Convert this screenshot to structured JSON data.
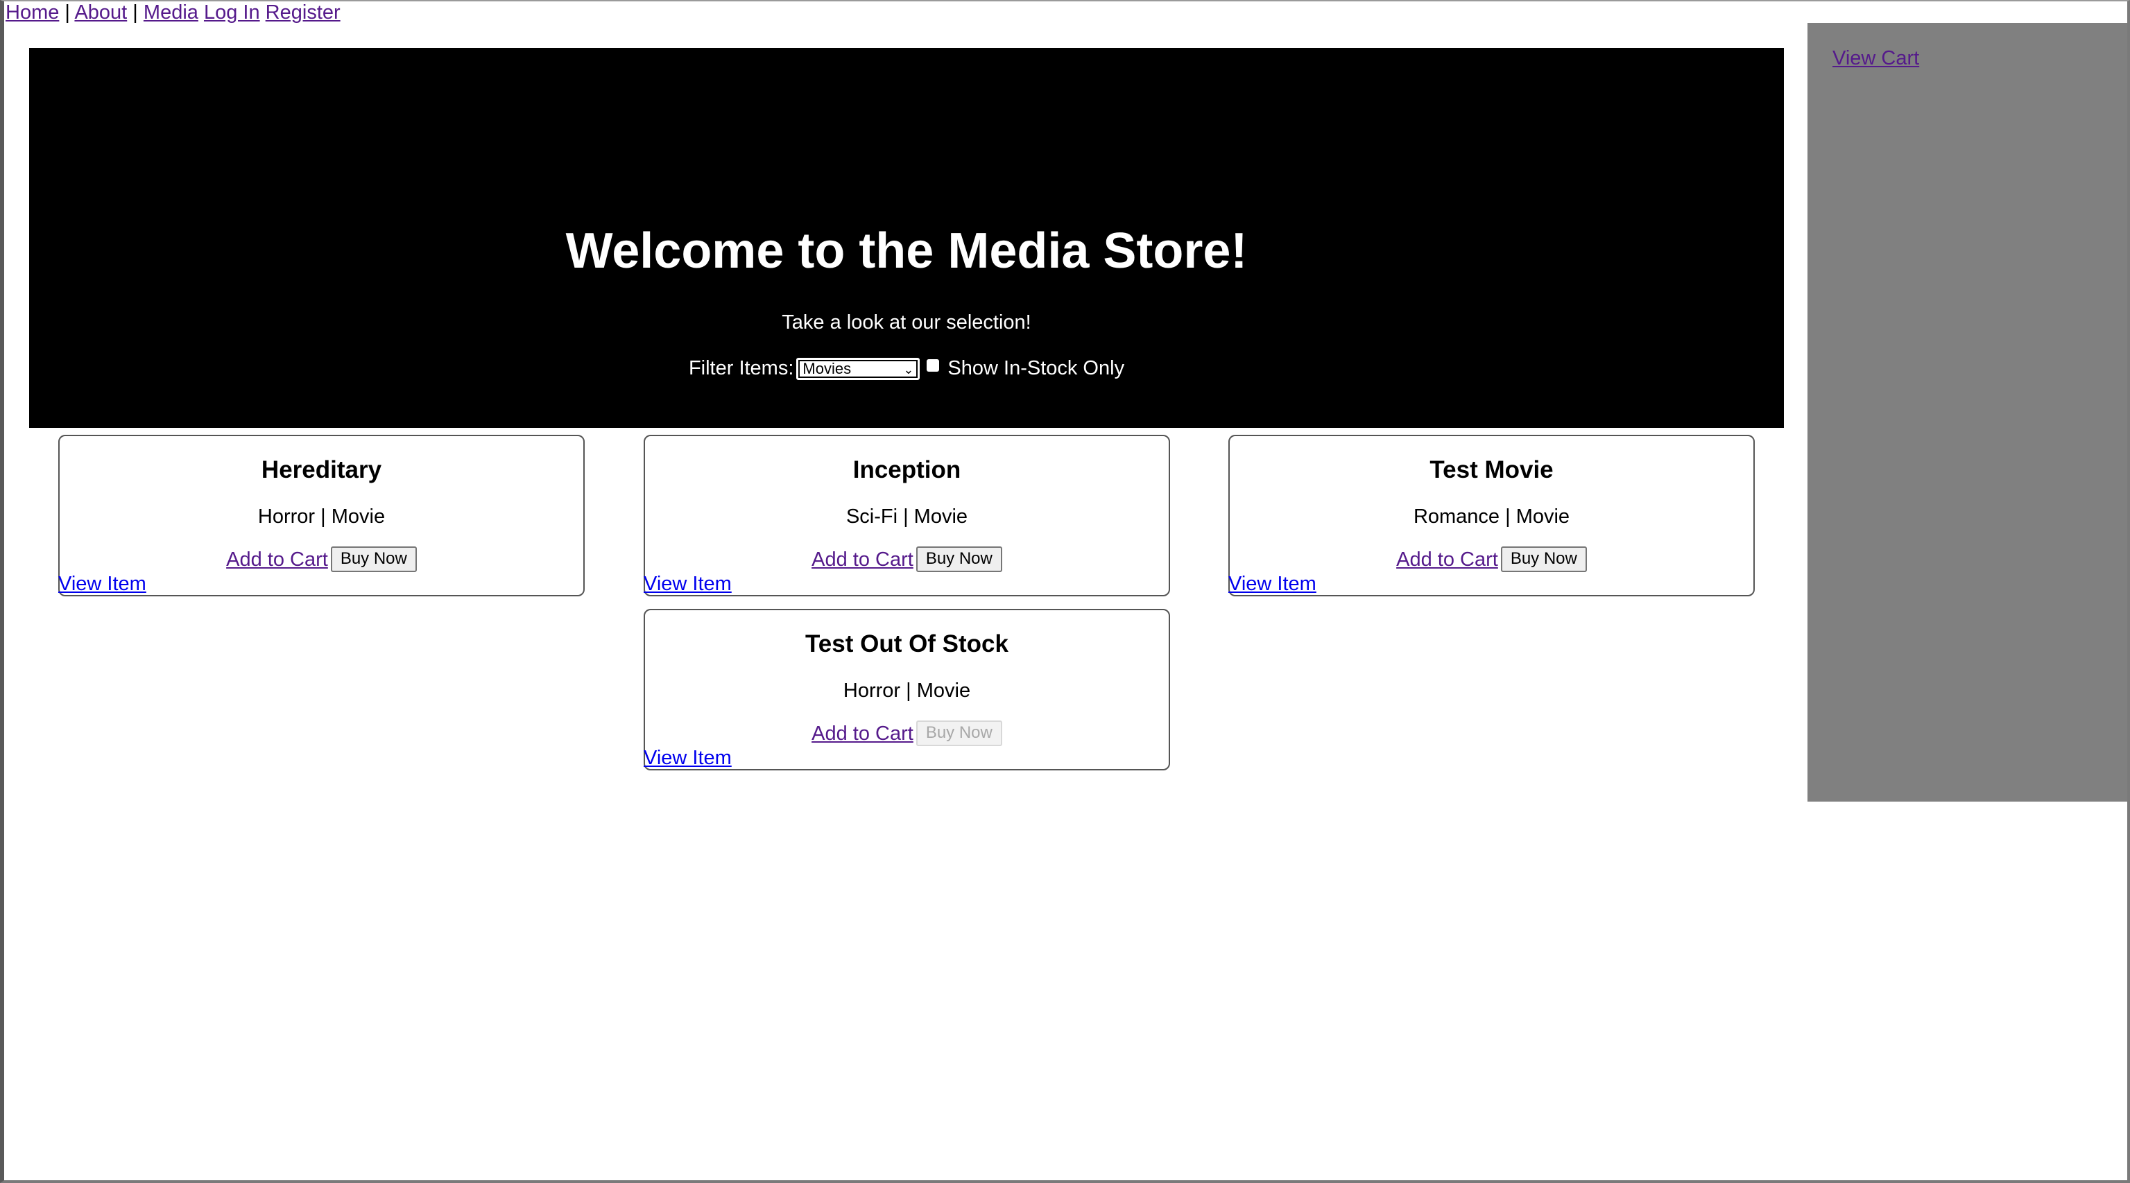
{
  "nav": {
    "home": "Home",
    "sep1": "|",
    "about": "About",
    "sep2": "|",
    "media": "Media",
    "login": "Log In",
    "register": "Register"
  },
  "hero": {
    "title": "Welcome to the Media Store!",
    "subtitle": "Take a look at our selection!",
    "filter_label": "Filter Items:",
    "filter_selected": "Movies",
    "instock_label": "Show In-Stock Only",
    "instock_checked": false
  },
  "sidebar": {
    "view_cart": "View Cart"
  },
  "icons": {
    "select_chevron": "chevron-down-icon"
  },
  "colors": {
    "hero_bg": "#000000",
    "sidebar_bg": "#808080",
    "visited_link": "#551a8b",
    "unvisited_link": "#0000ee"
  },
  "items": [
    {
      "title": "Hereditary",
      "genre": "Horror | Movie",
      "add_to_cart": "Add to Cart",
      "buy_now": "Buy Now",
      "buy_disabled": false,
      "view_item": "View Item"
    },
    {
      "title": "Inception",
      "genre": "Sci-Fi | Movie",
      "add_to_cart": "Add to Cart",
      "buy_now": "Buy Now",
      "buy_disabled": false,
      "view_item": "View Item"
    },
    {
      "title": "Test Movie",
      "genre": "Romance | Movie",
      "add_to_cart": "Add to Cart",
      "buy_now": "Buy Now",
      "buy_disabled": false,
      "view_item": "View Item"
    },
    {
      "title": "Test Out Of Stock",
      "genre": "Horror | Movie",
      "add_to_cart": "Add to Cart",
      "buy_now": "Buy Now",
      "buy_disabled": true,
      "view_item": "View Item"
    }
  ]
}
